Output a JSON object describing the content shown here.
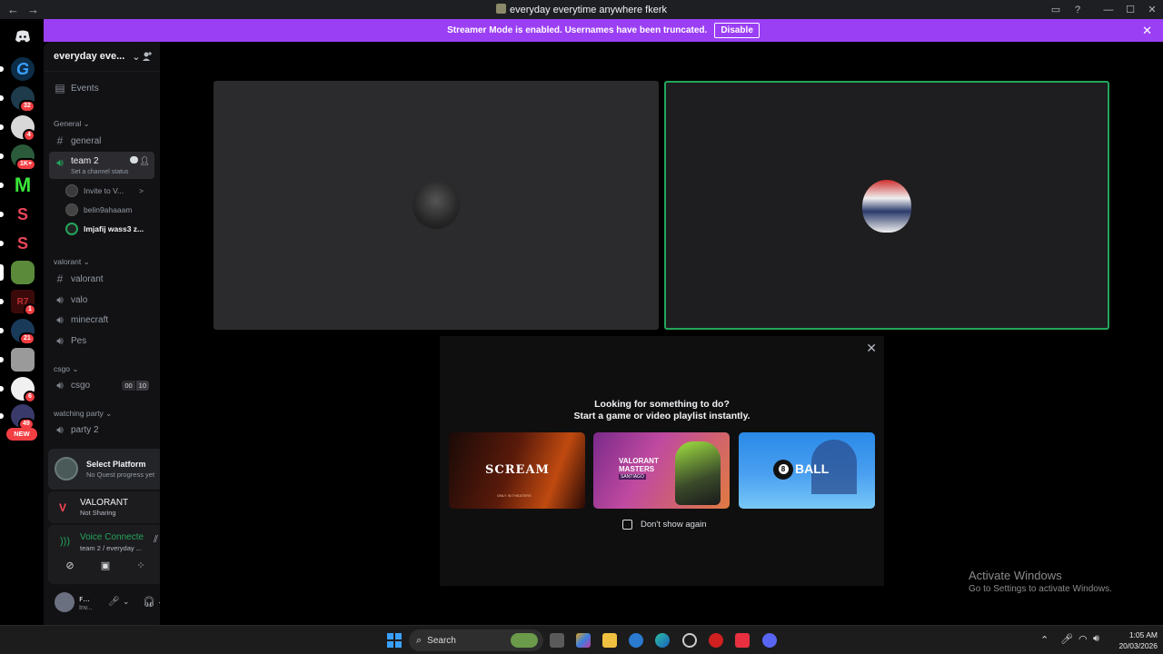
{
  "window": {
    "title": "everyday everytime anywhere fkerk",
    "nav_back": "←",
    "nav_forward": "→",
    "controls": [
      "▭",
      "?",
      "—",
      "☐",
      "✕"
    ]
  },
  "banner": {
    "text": "Streamer Mode is enabled. Usernames have been truncated.",
    "button": "Disable",
    "close": "✕"
  },
  "server_rail": {
    "badges": [
      "32",
      "4",
      "1K+",
      "1",
      "21",
      "6",
      "49"
    ],
    "new_label": "NEW",
    "letters": {
      "g": "G",
      "m": "M",
      "s1": "S",
      "s2": "S",
      "r": "R7"
    }
  },
  "server": {
    "name": "everyday eve...",
    "chevron": "⌄"
  },
  "sidebar": {
    "events": "Events",
    "categories": {
      "general": "General",
      "valorant": "valorant",
      "csgo": "csgo",
      "watching": "watching party"
    },
    "channels": {
      "general": "general",
      "team2": "team 2",
      "team2_status": "Set a channel status",
      "valorant": "valorant",
      "valo": "valo",
      "minecraft": "minecraft",
      "pes": "Pes",
      "csgo": "csgo",
      "party2": "party 2"
    },
    "csgo_counts": [
      "00",
      "10"
    ],
    "voice_users": [
      {
        "name": "Invite to V...",
        "chevron": ">"
      },
      {
        "name": "belin9ahaaam"
      },
      {
        "name": "lmjafij wass3 z..."
      }
    ]
  },
  "quest": {
    "title": "Select Platform",
    "sub": "No Quest progress yet"
  },
  "game": {
    "name": "VALORANT",
    "status": "Not Sharing"
  },
  "voice": {
    "status": "Voice Connecte",
    "sub": "team 2 / everyday ..."
  },
  "user": {
    "name": "ꜰ...",
    "status": "Inv..."
  },
  "popup": {
    "line1": "Looking for something to do?",
    "line2": "Start a game or video playlist instantly.",
    "close": "✕",
    "checkbox_label": "Don't show again",
    "checkbox_checked": false,
    "cards": [
      {
        "title": "SCREAM",
        "sub": "ONLY IN THEATERS"
      },
      {
        "title": "VALORANT MASTERS",
        "sub": "SANTIAGO"
      },
      {
        "title": "BALL",
        "sub": "8"
      }
    ]
  },
  "activate": {
    "title": "Activate Windows",
    "sub": "Go to Settings to activate Windows."
  },
  "taskbar": {
    "search_placeholder": "Search",
    "time": "1:05 AM",
    "date": "20/03/2026",
    "tray_up": "⌃"
  },
  "colors": {
    "accent_purple": "#9b3ff5",
    "speaking_green": "#23a55a",
    "badge_red": "#f23f43"
  }
}
